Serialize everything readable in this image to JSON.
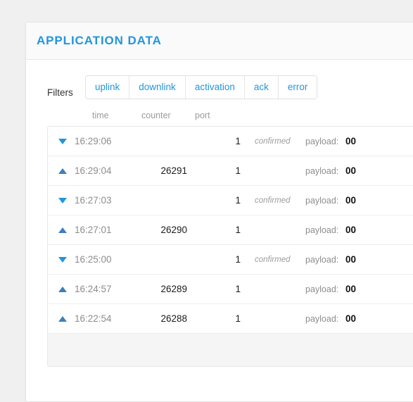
{
  "card": {
    "title": "APPLICATION DATA"
  },
  "filters": {
    "label": "Filters",
    "buttons": [
      {
        "label": "uplink"
      },
      {
        "label": "downlink"
      },
      {
        "label": "activation"
      },
      {
        "label": "ack"
      },
      {
        "label": "error"
      }
    ]
  },
  "table": {
    "headers": {
      "time": "time",
      "counter": "counter",
      "port": "port"
    },
    "payload_label": "payload:",
    "rows": [
      {
        "direction": "down",
        "icon": "triangle-down-icon",
        "time": "16:29:06",
        "counter": "",
        "port": "1",
        "confirmed": "confirmed",
        "payload": "00"
      },
      {
        "direction": "up",
        "icon": "triangle-up-icon",
        "time": "16:29:04",
        "counter": "26291",
        "port": "1",
        "confirmed": "",
        "payload": "00"
      },
      {
        "direction": "down",
        "icon": "triangle-down-icon",
        "time": "16:27:03",
        "counter": "",
        "port": "1",
        "confirmed": "confirmed",
        "payload": "00"
      },
      {
        "direction": "up",
        "icon": "triangle-up-icon",
        "time": "16:27:01",
        "counter": "26290",
        "port": "1",
        "confirmed": "",
        "payload": "00"
      },
      {
        "direction": "down",
        "icon": "triangle-down-icon",
        "time": "16:25:00",
        "counter": "",
        "port": "1",
        "confirmed": "confirmed",
        "payload": "00"
      },
      {
        "direction": "up",
        "icon": "triangle-up-icon",
        "time": "16:24:57",
        "counter": "26289",
        "port": "1",
        "confirmed": "",
        "payload": "00"
      },
      {
        "direction": "up",
        "icon": "triangle-up-icon",
        "time": "16:22:54",
        "counter": "26288",
        "port": "1",
        "confirmed": "",
        "payload": "00"
      }
    ]
  },
  "colors": {
    "accent": "#2196dd",
    "uplink_arrow": "#3b7fbf",
    "downlink_arrow": "#2196dd",
    "page_background": "#f0f0f0",
    "card_header_background": "#fafafa",
    "table_footer_background": "#f5f5f5"
  }
}
